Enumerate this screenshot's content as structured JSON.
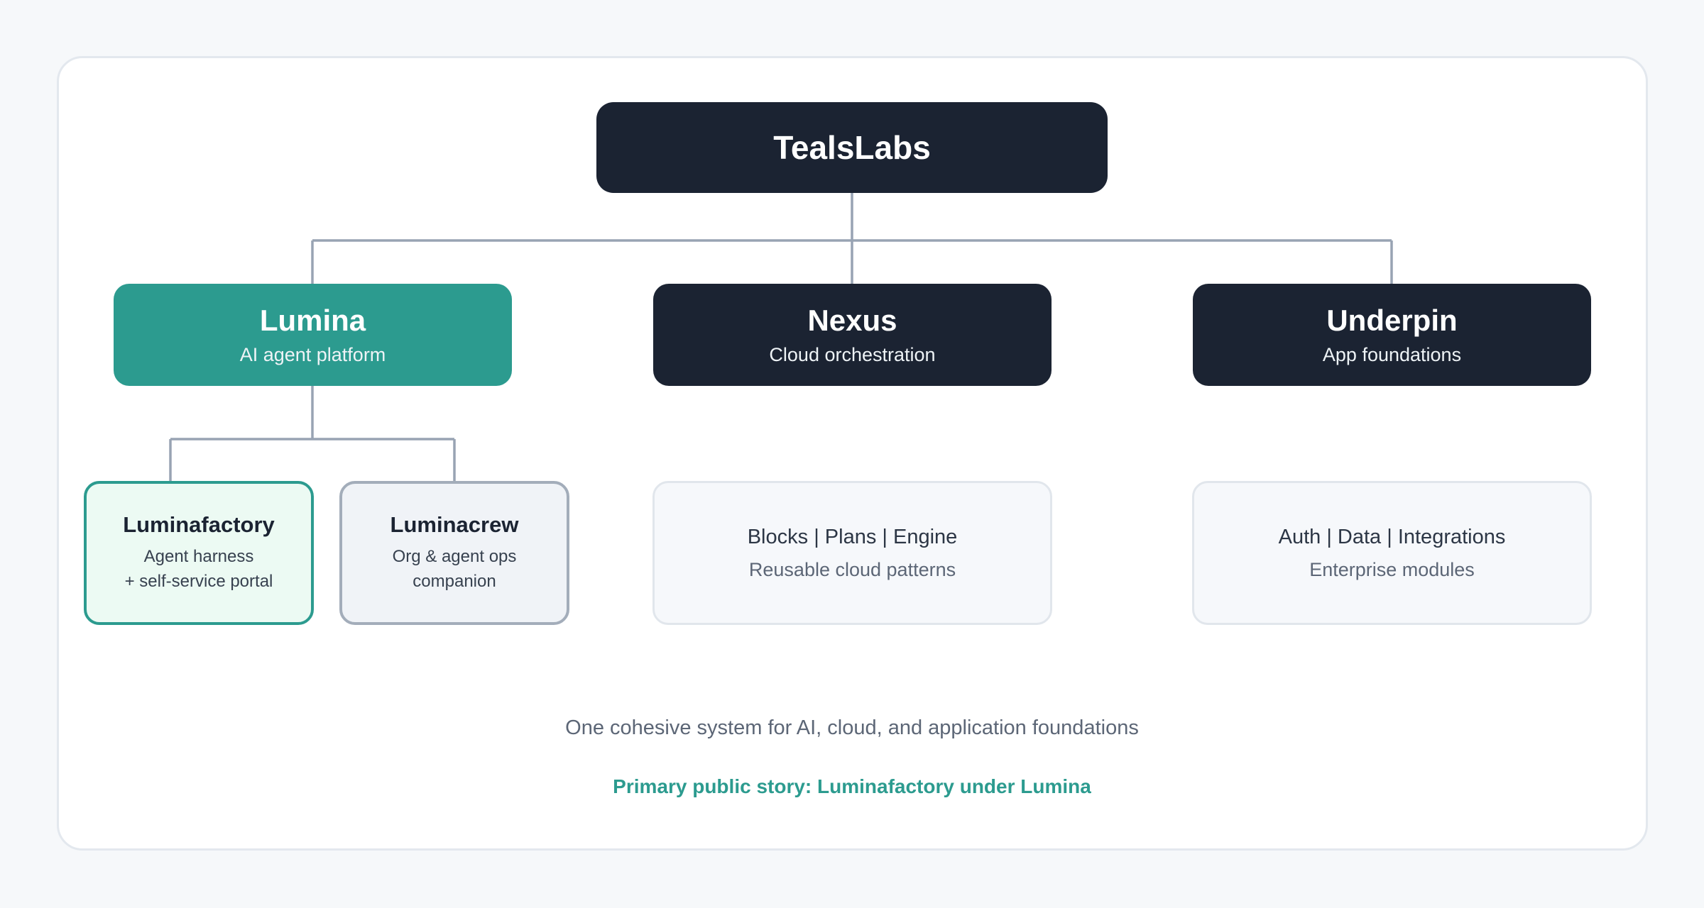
{
  "root": {
    "title": "TealsLabs"
  },
  "platforms": [
    {
      "title": "Lumina",
      "subtitle": "AI agent platform"
    },
    {
      "title": "Nexus",
      "subtitle": "Cloud orchestration"
    },
    {
      "title": "Underpin",
      "subtitle": "App foundations"
    }
  ],
  "lumina_products": [
    {
      "title": "Luminafactory",
      "desc_line1": "Agent harness",
      "desc_line2": "+ self-service portal"
    },
    {
      "title": "Luminacrew",
      "desc_line1": "Org & agent ops",
      "desc_line2": "companion"
    }
  ],
  "nexus_detail": {
    "items": "Blocks | Plans | Engine",
    "note": "Reusable cloud patterns"
  },
  "underpin_detail": {
    "items": "Auth | Data | Integrations",
    "note": "Enterprise modules"
  },
  "footer": {
    "summary": "One cohesive system for AI, cloud, and application foundations",
    "story": "Primary public story: Luminafactory under Lumina"
  },
  "colors": {
    "dark_node": "#1b2332",
    "accent_teal": "#2c9b8f",
    "connector": "#98a3b3",
    "background": "#f6f8fa"
  }
}
